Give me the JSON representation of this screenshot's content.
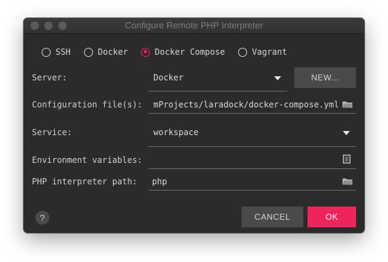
{
  "window": {
    "title": "Configure Remote PHP Interpreter"
  },
  "connection_types": [
    {
      "label": "SSH",
      "selected": false
    },
    {
      "label": "Docker",
      "selected": false
    },
    {
      "label": "Docker Compose",
      "selected": true
    },
    {
      "label": "Vagrant",
      "selected": false
    }
  ],
  "server": {
    "label": "Server:",
    "value": "Docker",
    "new_button": "NEW..."
  },
  "config_files": {
    "label": "Configuration file(s):",
    "value": "mProjects/laradock/docker-compose.yml"
  },
  "service": {
    "label": "Service:",
    "value": "workspace"
  },
  "env_vars": {
    "label": "Environment variables:",
    "value": ""
  },
  "php_path": {
    "label": "PHP interpreter path:",
    "value": "php"
  },
  "footer": {
    "help_label": "?",
    "cancel_label": "CANCEL",
    "ok_label": "OK"
  },
  "colors": {
    "accent": "#f0245d",
    "background": "#2b2b2b",
    "button": "#4a4a4a"
  },
  "icons": {
    "folder": "folder-icon",
    "dropdown": "chevron-down-icon",
    "document": "document-icon"
  }
}
